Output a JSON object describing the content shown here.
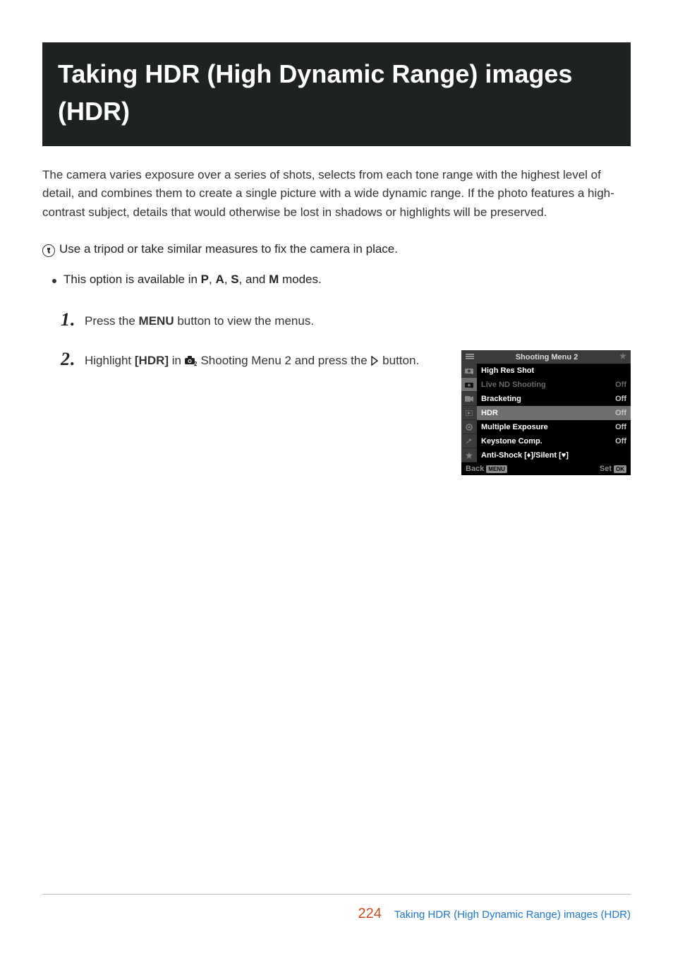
{
  "title": "Taking HDR (High Dynamic Range) images (HDR)",
  "intro": "The camera varies exposure over a series of shots, selects from each tone range with the highest level of detail, and combines them to create a single picture with a wide dynamic range. If the photo features a high-contrast subject, details that would otherwise be lost in shadows or highlights will be preserved.",
  "note": "Use a tripod or take similar measures to fix the camera in place.",
  "bullet": {
    "prefix": "This option is available in ",
    "mode_p": "P",
    "sep1": ", ",
    "mode_a": "A",
    "sep2": ", ",
    "mode_s": "S",
    "sep3": ", and ",
    "mode_m": "M",
    "suffix": " modes."
  },
  "steps": {
    "s1": {
      "num": "1",
      "dot": ".",
      "prefix": "Press the ",
      "menu": "MENU",
      "suffix": " button to view the menus."
    },
    "s2": {
      "num": "2",
      "dot": ".",
      "prefix": "Highlight ",
      "hdr": "[HDR]",
      "mid": " in ",
      "suffix1": " Shooting Menu 2 and press the ",
      "suffix2": " button."
    }
  },
  "camMenu": {
    "title": "Shooting Menu 2",
    "items": [
      {
        "label": "High Res Shot",
        "val": "",
        "disabled": false
      },
      {
        "label": "Live ND Shooting",
        "val": "Off",
        "disabled": true
      },
      {
        "label": "Bracketing",
        "val": "Off",
        "disabled": false
      },
      {
        "label": "HDR",
        "val": "Off",
        "disabled": false,
        "selected": true
      },
      {
        "label": "Multiple Exposure",
        "val": "Off",
        "disabled": false
      },
      {
        "label": "Keystone Comp.",
        "val": "Off",
        "disabled": false
      },
      {
        "label": "Anti-Shock [♦]/Silent [♥]",
        "val": "",
        "disabled": false
      }
    ],
    "footer": {
      "back": "Back",
      "backPill": "MENU",
      "set": "Set",
      "setPill": "OK"
    }
  },
  "footer": {
    "pageNum": "224",
    "link": "Taking HDR (High Dynamic Range) images (HDR)"
  }
}
